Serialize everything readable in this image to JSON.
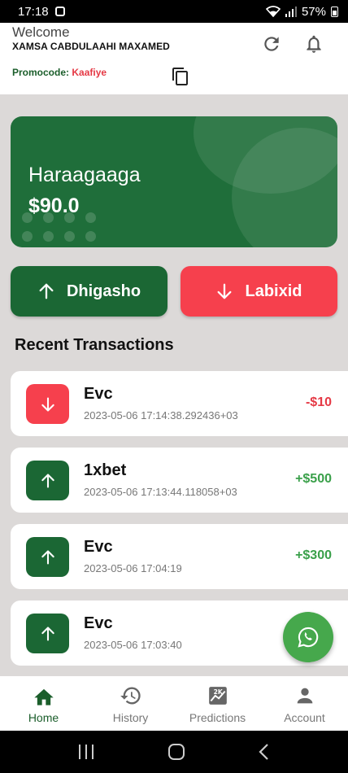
{
  "status_bar": {
    "time": "17:18",
    "battery": "57%"
  },
  "header": {
    "welcome": "Welcome",
    "user_name": "XAMSA CABDULAAHI MAXAMED",
    "promo_label": "Promocode:",
    "promo_value": "Kaafiye"
  },
  "balance": {
    "label": "Haraagaaga",
    "value": "$90.0"
  },
  "actions": {
    "deposit": "Dhigasho",
    "withdraw": "Labixid"
  },
  "section_title": "Recent Transactions",
  "transactions": [
    {
      "title": "Evc",
      "date": "2023-05-06 17:14:38.292436+03",
      "amount": "-$10",
      "direction": "down"
    },
    {
      "title": "1xbet",
      "date": "2023-05-06 17:13:44.118058+03",
      "amount": "+$500",
      "direction": "up"
    },
    {
      "title": "Evc",
      "date": "2023-05-06 17:04:19",
      "amount": "+$300",
      "direction": "up"
    },
    {
      "title": "Evc",
      "date": "2023-05-06 17:03:40",
      "amount": "",
      "direction": "up"
    }
  ],
  "nav": [
    {
      "label": "Home",
      "icon": "home-icon",
      "active": true
    },
    {
      "label": "History",
      "icon": "history-icon",
      "active": false
    },
    {
      "label": "Predictions",
      "icon": "predictions-icon",
      "active": false
    },
    {
      "label": "Account",
      "icon": "account-icon",
      "active": false
    }
  ],
  "colors": {
    "primary_green": "#1b6734",
    "accent_red": "#f6404d",
    "positive": "#3aa04a",
    "negative": "#e53945"
  }
}
